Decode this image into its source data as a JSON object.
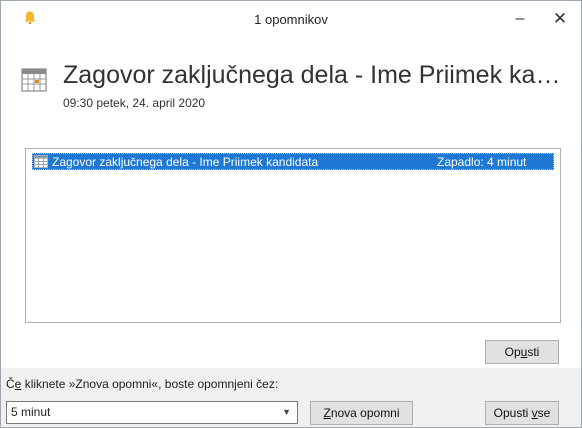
{
  "window": {
    "title": "1 opomnikov"
  },
  "controls": {
    "minimize": "–",
    "close": "✕"
  },
  "header": {
    "subject": "Zagovor zaključnega dela - Ime Priimek kandi...",
    "when": "09:30 petek, 24. april 2020"
  },
  "reminders": [
    {
      "subject": "Zagovor zaključnega dela - Ime Priimek kandidata",
      "due": "Zapadlo: 4 minut",
      "selected": true
    }
  ],
  "buttons": {
    "dismiss": {
      "pre": "Op",
      "key": "u",
      "post": "sti"
    },
    "snooze": {
      "pre": "",
      "key": "Z",
      "post": "nova opomni"
    },
    "dismiss_all": {
      "pre": "Opusti ",
      "key": "v",
      "post": "se"
    }
  },
  "snooze_label": {
    "pre": "Č",
    "key": "e",
    "post": " kliknete »Znova opomni«, boste opomnjeni čez:"
  },
  "snooze_select": {
    "value": "5 minut"
  },
  "icons": {
    "bell": "bell-icon",
    "calendar": "calendar-icon",
    "item": "appointment-icon"
  },
  "colors": {
    "selection": "#1f78d4",
    "bell": "#f2b72e"
  }
}
